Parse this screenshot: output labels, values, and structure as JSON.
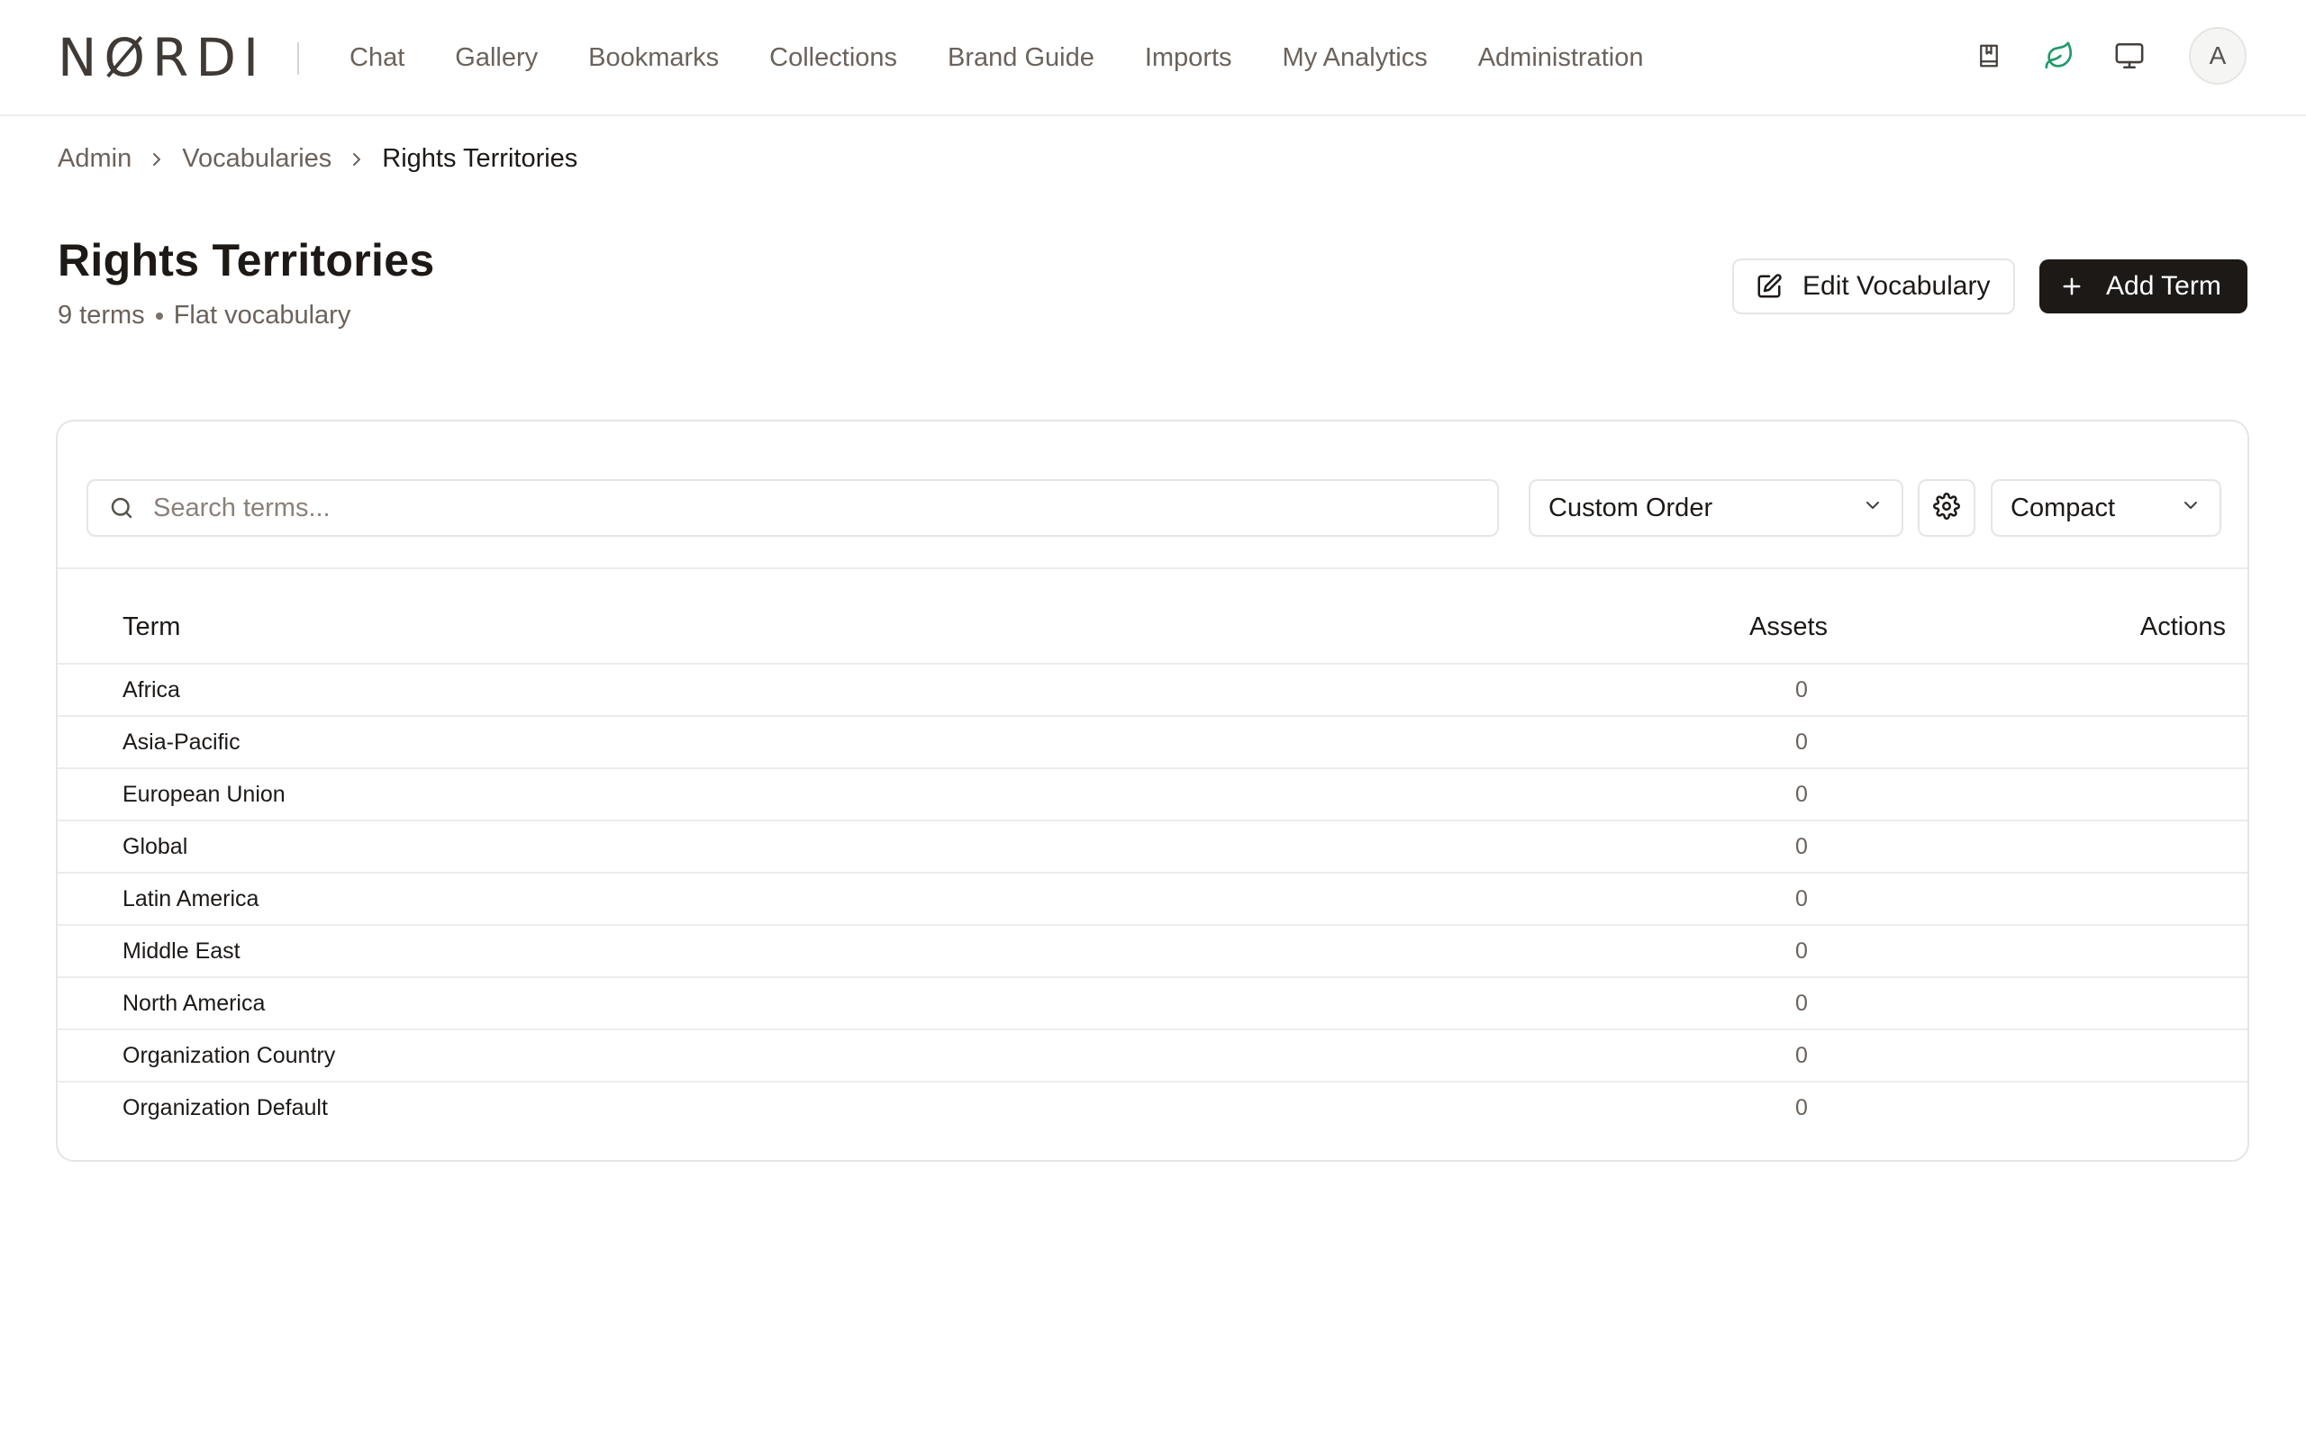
{
  "brand": {
    "logo": "NØRDI",
    "accent": "#1f9a6a",
    "dark": "#1c1917"
  },
  "nav": [
    {
      "label": "Chat"
    },
    {
      "label": "Gallery"
    },
    {
      "label": "Bookmarks"
    },
    {
      "label": "Collections"
    },
    {
      "label": "Brand Guide"
    },
    {
      "label": "Imports"
    },
    {
      "label": "My Analytics"
    },
    {
      "label": "Administration"
    }
  ],
  "header_icons": [
    "bookmark-book-icon",
    "leaf-icon",
    "monitor-icon"
  ],
  "user": {
    "initial": "A"
  },
  "breadcrumb": [
    {
      "label": "Admin"
    },
    {
      "label": "Vocabularies"
    },
    {
      "label": "Rights Territories"
    }
  ],
  "page": {
    "title": "Rights Territories",
    "term_count": "9 terms",
    "vocab_type": "Flat vocabulary",
    "edit_label": "Edit Vocabulary",
    "add_label": "Add Term"
  },
  "toolbar": {
    "search_placeholder": "Search terms...",
    "sort_value": "Custom Order",
    "view_value": "Compact"
  },
  "table": {
    "columns": {
      "term": "Term",
      "assets": "Assets",
      "actions": "Actions"
    },
    "rows": [
      {
        "term": "Africa",
        "assets": "0"
      },
      {
        "term": "Asia-Pacific",
        "assets": "0"
      },
      {
        "term": "European Union",
        "assets": "0"
      },
      {
        "term": "Global",
        "assets": "0"
      },
      {
        "term": "Latin America",
        "assets": "0"
      },
      {
        "term": "Middle East",
        "assets": "0"
      },
      {
        "term": "North America",
        "assets": "0"
      },
      {
        "term": "Organization Country",
        "assets": "0"
      },
      {
        "term": "Organization Default",
        "assets": "0"
      }
    ]
  }
}
